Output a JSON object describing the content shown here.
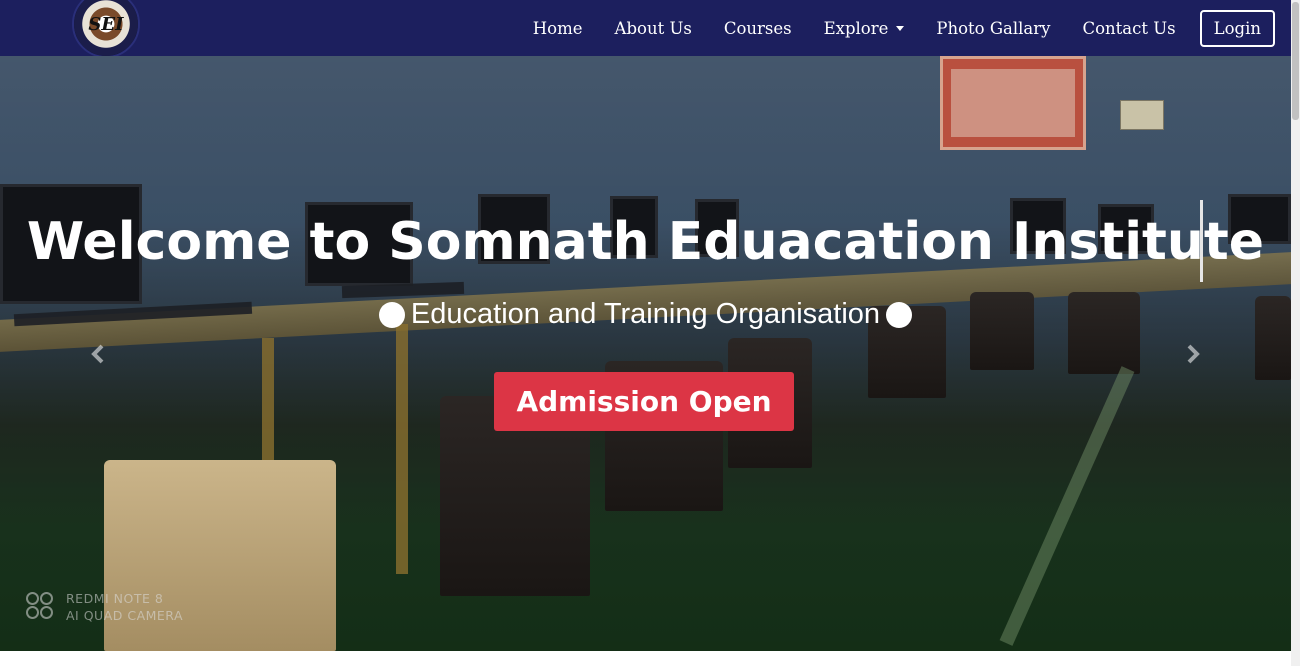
{
  "navbar": {
    "logo_text": "SEI",
    "links": [
      {
        "label": "Home"
      },
      {
        "label": "About Us"
      },
      {
        "label": "Courses"
      },
      {
        "label": "Explore"
      },
      {
        "label": "Photo Gallary"
      },
      {
        "label": "Contact Us"
      }
    ],
    "login_label": "Login",
    "background_color": "#1c1f5e"
  },
  "hero": {
    "title": "Welcome to Somnath Eduacation Institute",
    "subtitle": "Education and Training Organisation",
    "admission_button_label": "Admission Open",
    "admission_button_color": "#dc3545",
    "watermark_line1": "REDMI NOTE 8",
    "watermark_line2": "AI QUAD CAMERA",
    "prev_icon": "chevron-left-icon",
    "next_icon": "chevron-right-icon"
  }
}
